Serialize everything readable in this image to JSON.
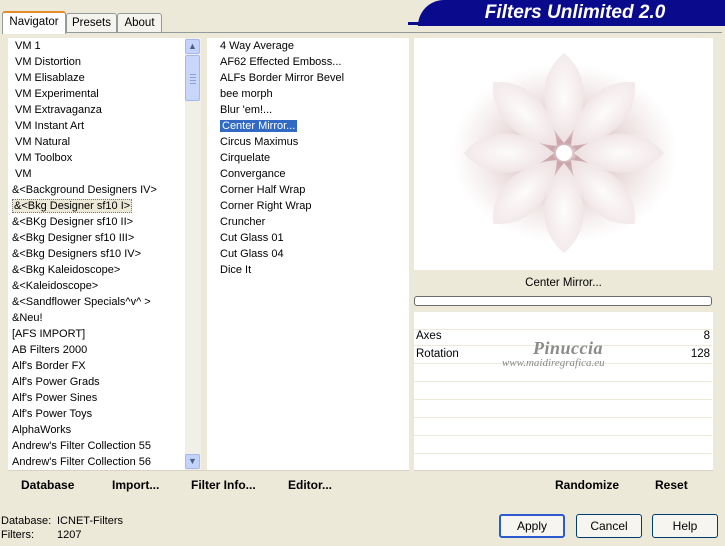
{
  "tabs": [
    {
      "label": "Navigator"
    },
    {
      "label": "Presets"
    },
    {
      "label": "About"
    }
  ],
  "banner_title": "Filters Unlimited 2.0",
  "categories": [
    "VM 1",
    "VM Distortion",
    "VM Elisablaze",
    "VM Experimental",
    "VM Extravaganza",
    "VM Instant Art",
    "VM Natural",
    "VM Toolbox",
    "VM",
    "&<Background Designers IV>",
    "&<Bkg Designer sf10 I>",
    "&<BKg Designer sf10 II>",
    "&<Bkg Designer sf10 III>",
    "&<Bkg Designers sf10 IV>",
    "&<Bkg Kaleidoscope>",
    "&<Kaleidoscope>",
    "&<Sandflower Specials^v^ >",
    "&Neu!",
    "[AFS IMPORT]",
    "AB Filters 2000",
    "Alf's Border FX",
    "Alf's Power Grads",
    "Alf's Power Sines",
    "Alf's Power Toys",
    "AlphaWorks",
    "Andrew's Filter Collection 55",
    "Andrew's Filter Collection 56"
  ],
  "selected_category": "&<Bkg Designer sf10 I>",
  "filters": [
    "4 Way Average",
    "AF62 Effected Emboss...",
    "ALFs Border Mirror Bevel",
    "bee morph",
    "Blur 'em!...",
    "Center Mirror...",
    "Circus Maximus",
    "Cirquelate",
    "Convergance",
    "Corner Half Wrap",
    "Corner Right Wrap",
    "Cruncher",
    "Cut Glass  01",
    "Cut Glass 04",
    "Dice It"
  ],
  "selected_filter": "Center Mirror...",
  "preview_filter_name": "Center Mirror...",
  "progress": 0,
  "params": [
    {
      "name": "Axes",
      "value": "8"
    },
    {
      "name": "Rotation",
      "value": "128"
    }
  ],
  "watermark": {
    "line1": "Pinuccia",
    "line2": "www.maidiregrafica.eu"
  },
  "bottom_bar": {
    "database": "Database",
    "import": "Import...",
    "filter_info": "Filter Info...",
    "editor": "Editor...",
    "randomize": "Randomize",
    "reset": "Reset"
  },
  "status": {
    "database_label": "Database:",
    "database_value": "ICNET-Filters",
    "filters_label": "Filters:",
    "filters_value": "1207"
  },
  "buttons": {
    "apply": "Apply",
    "cancel": "Cancel",
    "help": "Help"
  },
  "colors": {
    "selection": "#316ac5",
    "banner": "#0a0a8c",
    "preview_tint": "#c9a4aa"
  }
}
